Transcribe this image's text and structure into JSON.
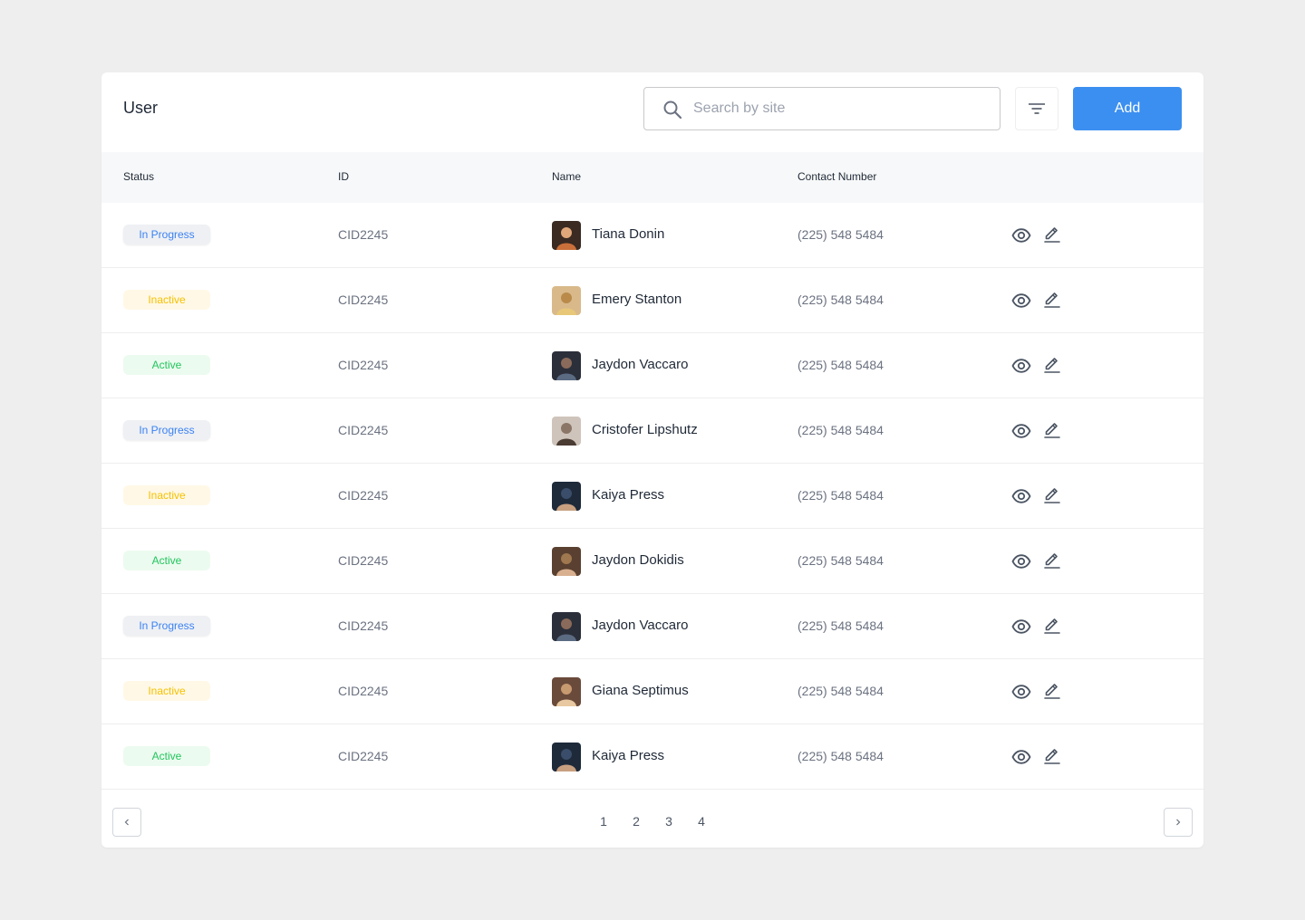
{
  "header": {
    "title": "User",
    "search_placeholder": "Search by site",
    "add_label": "Add"
  },
  "columns": [
    "Status",
    "ID",
    "Name",
    "Contact Number"
  ],
  "rows": [
    {
      "status": "In Progress",
      "status_type": "progress",
      "id": "CID2245",
      "name": "Tiana Donin",
      "phone": "(225) 548 5484"
    },
    {
      "status": "Inactive",
      "status_type": "inactive",
      "id": "CID2245",
      "name": "Emery Stanton",
      "phone": "(225) 548 5484"
    },
    {
      "status": "Active",
      "status_type": "active",
      "id": "CID2245",
      "name": "Jaydon Vaccaro",
      "phone": "(225) 548 5484"
    },
    {
      "status": "In Progress",
      "status_type": "progress",
      "id": "CID2245",
      "name": "Cristofer Lipshutz",
      "phone": "(225) 548 5484"
    },
    {
      "status": "Inactive",
      "status_type": "inactive",
      "id": "CID2245",
      "name": "Kaiya Press",
      "phone": "(225) 548 5484"
    },
    {
      "status": "Active",
      "status_type": "active",
      "id": "CID2245",
      "name": "Jaydon Dokidis",
      "phone": "(225) 548 5484"
    },
    {
      "status": "In Progress",
      "status_type": "progress",
      "id": "CID2245",
      "name": "Jaydon Vaccaro",
      "phone": "(225) 548 5484"
    },
    {
      "status": "Inactive",
      "status_type": "inactive",
      "id": "CID2245",
      "name": "Giana Septimus",
      "phone": "(225) 548 5484"
    },
    {
      "status": "Active",
      "status_type": "active",
      "id": "CID2245",
      "name": "Kaiya Press",
      "phone": "(225) 548 5484"
    }
  ],
  "pagination": {
    "pages": [
      "1",
      "2",
      "3",
      "4"
    ]
  },
  "colors": {
    "accent": "#3b8ff0",
    "progress": "#3b82f6",
    "inactive": "#f5c100",
    "active": "#22c55e"
  },
  "icons": {
    "search": "search-icon",
    "filter": "filter-icon",
    "view": "eye-icon",
    "edit": "pencil-icon",
    "prev": "chevron-left-icon",
    "next": "chevron-right-icon"
  }
}
